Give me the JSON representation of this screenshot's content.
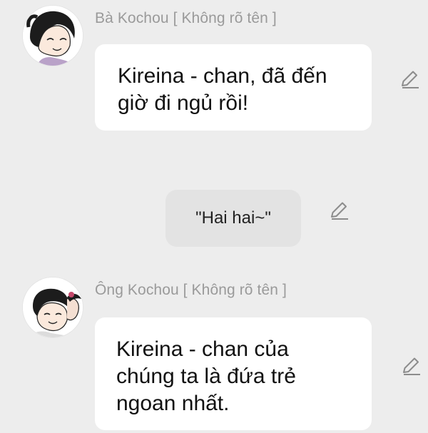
{
  "messages": [
    {
      "sender": "Bà Kochou [ Không rõ tên ]",
      "text_lines": [
        "Kireina - chan, đã đến",
        "giờ đi ngủ rồi!"
      ],
      "edit_icon": "pencil-icon"
    },
    {
      "text": "\"Hai hai~\"",
      "edit_icon": "pencil-icon"
    },
    {
      "sender": "Ông Kochou [ Không rõ tên ]",
      "text_lines": [
        "Kireina - chan của",
        "chúng ta là đứa trẻ",
        "ngoan nhất."
      ],
      "edit_icon": "pencil-icon"
    }
  ],
  "colors": {
    "background": "#ededed",
    "bubble_incoming": "#ffffff",
    "bubble_outgoing": "#e3e3e3",
    "sender_text": "#9a9a9a"
  }
}
